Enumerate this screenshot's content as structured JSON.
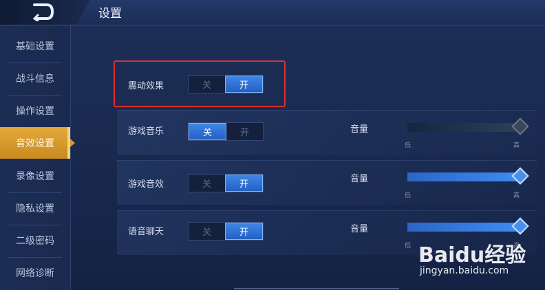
{
  "header": {
    "title": "设置",
    "back_icon": "back-arrow-icon"
  },
  "sidebar": {
    "items": [
      {
        "label": "基础设置"
      },
      {
        "label": "战斗信息"
      },
      {
        "label": "操作设置"
      },
      {
        "label": "音效设置",
        "active": true
      },
      {
        "label": "录像设置"
      },
      {
        "label": "隐私设置"
      },
      {
        "label": "二级密码"
      },
      {
        "label": "网络诊断"
      }
    ]
  },
  "settings": {
    "rows": [
      {
        "label": "震动效果",
        "off_label": "关",
        "on_label": "开",
        "state": "on",
        "highlighted": true
      },
      {
        "label": "游戏音乐",
        "off_label": "关",
        "on_label": "开",
        "state": "off",
        "volume_label": "音量",
        "volume": 1.0,
        "low_label": "低",
        "high_label": "高"
      },
      {
        "label": "游戏音效",
        "off_label": "关",
        "on_label": "开",
        "state": "on",
        "volume_label": "音量",
        "volume": 1.0,
        "low_label": "低",
        "high_label": "高"
      },
      {
        "label": "语音聊天",
        "off_label": "关",
        "on_label": "开",
        "state": "on",
        "volume_label": "音量",
        "volume": 1.0,
        "low_label": "低",
        "high_label": "高"
      }
    ]
  },
  "colors": {
    "accent": "#3e86e6",
    "active_tab": "#e3a93a",
    "highlight_border": "#e0302a"
  },
  "watermark": {
    "logo": "Baidu经验",
    "url": "jingyan.baidu.com"
  }
}
